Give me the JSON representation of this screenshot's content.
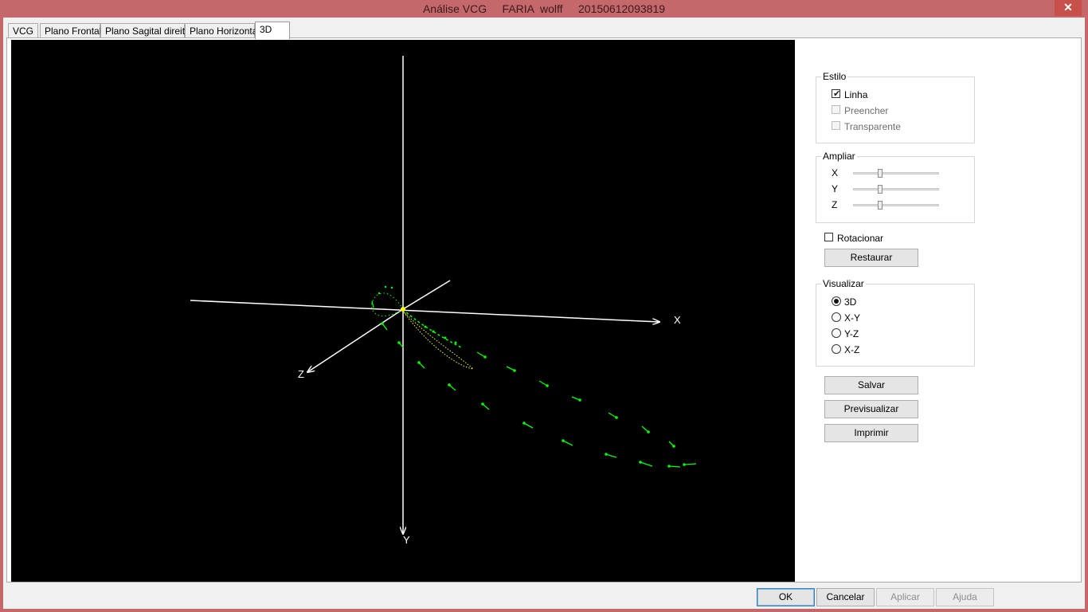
{
  "window": {
    "title": "Análise VCG     FARIA  wolff     20150612093819",
    "close_glyph": "✕"
  },
  "tabs": [
    {
      "label": "VCG"
    },
    {
      "label": "Plano Frontal"
    },
    {
      "label": "Plano Sagital direito"
    },
    {
      "label": "Plano Horizontal"
    },
    {
      "label": "3D"
    }
  ],
  "active_tab": "3D",
  "plot": {
    "axis_labels": {
      "x": "X",
      "y": "Y",
      "z": "Z"
    },
    "colors": {
      "background": "#000000",
      "axes": "#ffffff",
      "loop": "#00ff00",
      "t_loop": "#ffff00"
    }
  },
  "estilo": {
    "title": "Estilo",
    "options": [
      {
        "label": "Linha",
        "checked": true,
        "enabled": true
      },
      {
        "label": "Preencher",
        "checked": false,
        "enabled": false
      },
      {
        "label": "Transparente",
        "checked": false,
        "enabled": false
      }
    ]
  },
  "ampliar": {
    "title": "Ampliar",
    "sliders": [
      {
        "label": "X",
        "level": 0.3
      },
      {
        "label": "Y",
        "level": 0.3
      },
      {
        "label": "Z",
        "level": 0.3
      }
    ]
  },
  "rotacionar": {
    "label": "Rotacionar",
    "checked": false
  },
  "restaurar_label": "Restaurar",
  "visualizar": {
    "title": "Visualizar",
    "options": [
      {
        "label": "3D",
        "selected": true
      },
      {
        "label": "X-Y",
        "selected": false
      },
      {
        "label": "Y-Z",
        "selected": false
      },
      {
        "label": "X-Z",
        "selected": false
      }
    ]
  },
  "actions": {
    "salvar": "Salvar",
    "previsualizar": "Previsualizar",
    "imprimir": "Imprimir"
  },
  "footer": {
    "ok": "OK",
    "cancelar": "Cancelar",
    "aplicar": "Aplicar",
    "ajuda": "Ajuda"
  }
}
